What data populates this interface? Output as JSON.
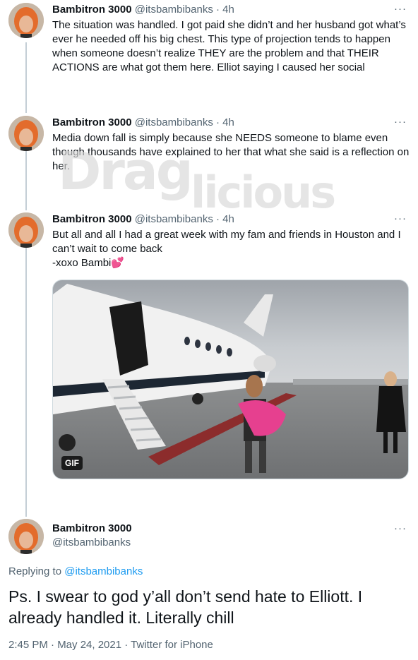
{
  "tweets": [
    {
      "name": "Bambitron 3000",
      "handle": "@itsbambibanks",
      "time": "4h",
      "more_icon": "ellipsis-icon",
      "text": "The situation was handled. I got paid she didn’t and her husband got what’s ever he needed off his big chest. This type of projection tends to happen when someone doesn’t realize THEY are the problem and that THEIR ACTIONS are what got them here. Elliot saying I caused her social"
    },
    {
      "name": "Bambitron 3000",
      "handle": "@itsbambibanks",
      "time": "4h",
      "more_icon": "ellipsis-icon",
      "text": "Media down fall is simply because she NEEDS someone to blame even though thousands have explained to her that what she said is a reflection on her."
    },
    {
      "name": "Bambitron 3000",
      "handle": "@itsbambibanks",
      "time": "4h",
      "more_icon": "ellipsis-icon",
      "text_line1": "But all and all I had a great week with my fam and friends in Houston and I can’t wait to come back",
      "text_line2": "-xoxo Bambi💕",
      "media_badge": "GIF"
    }
  ],
  "watermark": {
    "part1": "Drag",
    "part2": "licious"
  },
  "main_tweet": {
    "name": "Bambitron 3000",
    "handle": "@itsbambibanks",
    "reply_label": "Replying to ",
    "reply_handle": "@itsbambibanks",
    "text": "Ps. I swear to god y’all don’t send hate to Elliott. I already handled it. Literally chill",
    "timestamp": "2:45 PM · May 24, 2021 · Twitter for iPhone"
  },
  "colors": {
    "link": "#1d9bf0",
    "secondary": "#536471",
    "thread_line": "#c4cfd6"
  }
}
